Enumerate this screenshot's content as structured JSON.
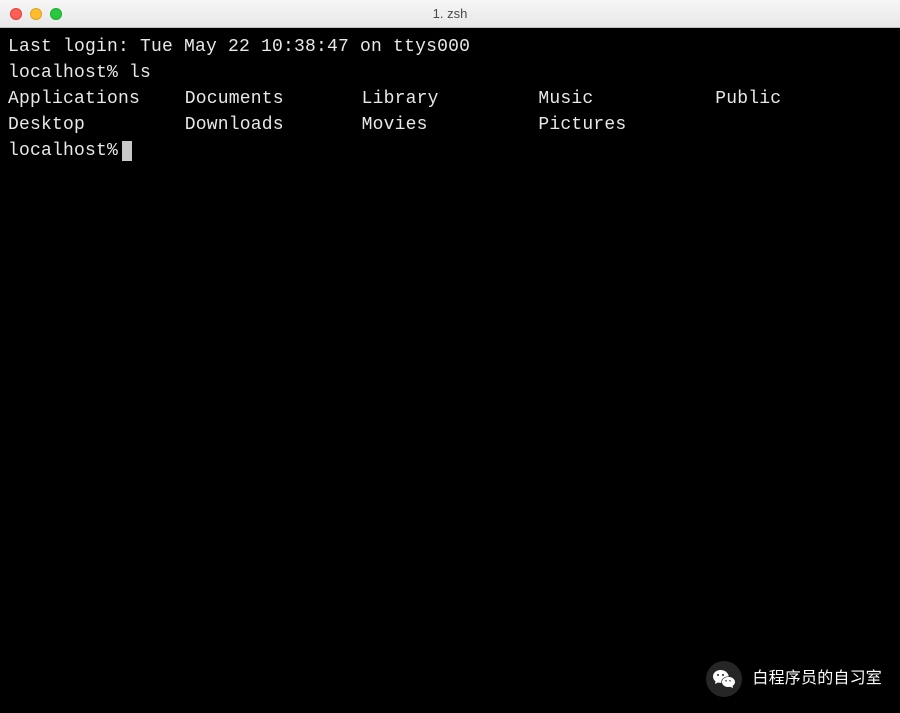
{
  "window": {
    "title": "1. zsh"
  },
  "terminal": {
    "last_login": "Last login: Tue May 22 10:38:47 on ttys000",
    "prompt": "localhost%",
    "command": "ls",
    "ls_output": {
      "row1": [
        "Applications",
        "Documents",
        "Library",
        "Music",
        "Public"
      ],
      "row2": [
        "Desktop",
        "Downloads",
        "Movies",
        "Pictures",
        ""
      ]
    }
  },
  "watermark": {
    "text": "白程序员的自习室"
  }
}
